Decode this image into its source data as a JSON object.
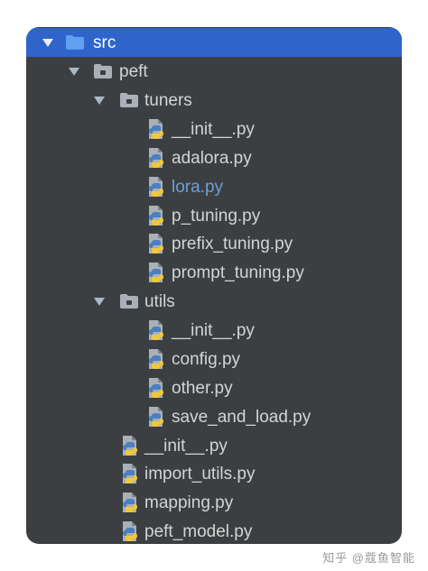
{
  "tree": {
    "root": {
      "label": "src"
    },
    "peft": {
      "label": "peft"
    },
    "tuners": {
      "label": "tuners",
      "files": [
        "__init__.py",
        "adalora.py",
        "lora.py",
        "p_tuning.py",
        "prefix_tuning.py",
        "prompt_tuning.py"
      ]
    },
    "utils": {
      "label": "utils",
      "files": [
        "__init__.py",
        "config.py",
        "other.py",
        "save_and_load.py"
      ]
    },
    "peft_files": [
      "__init__.py",
      "import_utils.py",
      "mapping.py",
      "peft_model.py"
    ]
  },
  "watermark": "知乎 @蔻鱼智能",
  "colors": {
    "panel_bg": "#3c3f41",
    "selection": "#2f65ca",
    "text": "#d4d4d4",
    "active_file_text": "#6d9fd6",
    "folder_blue": "#5fa0f0",
    "folder_grey": "#a9b0b8",
    "python_blue": "#4b7fbf",
    "python_yellow": "#f0c93a"
  },
  "icons": {
    "expanded_folder": "chevron-down-icon",
    "folder": "folder-icon",
    "python_file": "python-file-icon"
  }
}
